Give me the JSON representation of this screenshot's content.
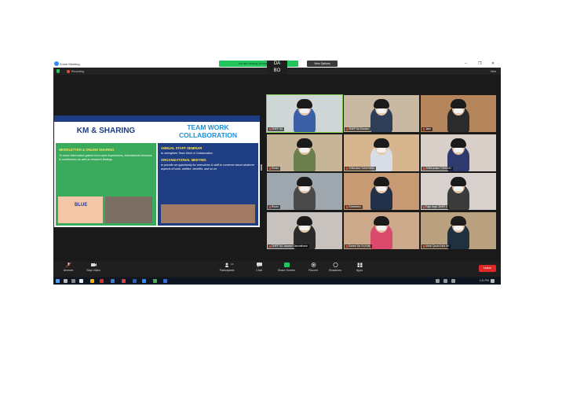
{
  "window": {
    "title": "Zoom Meeting",
    "controls": [
      "–",
      "❐",
      "✕"
    ]
  },
  "banner": {
    "sharing_text": "You are viewing Norman's screen",
    "view_options": "View Options",
    "logo_top": "DA",
    "logo_bottom": "BO"
  },
  "topbar": {
    "recording": "Recording",
    "view": "View"
  },
  "share": {
    "left_title": "KM & SHARING",
    "left_sub": "NEWSLETTER & ONLINE SHARING",
    "left_text": "To share information gained from work experiences, international seminars & conferences as well as research findings",
    "left_photo_label": "BLUE",
    "right_title_1": "TEAM WORK",
    "right_title_2": "COLLABORATION",
    "right_sub1": "ANNUAL STAFF SEMINAR",
    "right_text1": "to strengthen Team Work & Collaboration",
    "right_sub2": "ORGANIZATIONAL MEETING",
    "right_text2": "to provide an opportunity for executives & staff to converse about whatever aspects of work, welfare, benefits, and so on"
  },
  "participants": [
    {
      "name": "ONEP DA"
    },
    {
      "name": "ONEP DA Director"
    },
    {
      "name": "Jane"
    },
    {
      "name": "Kenzo"
    },
    {
      "name": "JVMA Akio TAKAYAMA"
    },
    {
      "name": "JVMA Asako TOMONO"
    },
    {
      "name": "Room"
    },
    {
      "name": "Cheerdono"
    },
    {
      "name": "Fujie Usyn ONEP Li"
    },
    {
      "name": "ONEP DA Jaswant Sakurathana"
    },
    {
      "name": "Kamon Ha Yo (Kob)"
    },
    {
      "name": "Ulrich Qusto Kaliz Mt"
    }
  ],
  "toolbar": {
    "unmute": "Unmute",
    "stop_video": "Stop Video",
    "participants": "Participants",
    "participants_count": "14",
    "chat": "Chat",
    "share_screen": "Share Screen",
    "record": "Record",
    "reactions": "Reactions",
    "apps": "Apps",
    "leave": "Leave"
  },
  "taskbar": {
    "time": "1:41 PM"
  },
  "colors": {
    "zoom_blue": "#2d8cff",
    "share_green": "#22c55e",
    "leave_red": "#e02828",
    "slide_navy": "#1f3d82",
    "slide_green": "#3aaa5c"
  }
}
